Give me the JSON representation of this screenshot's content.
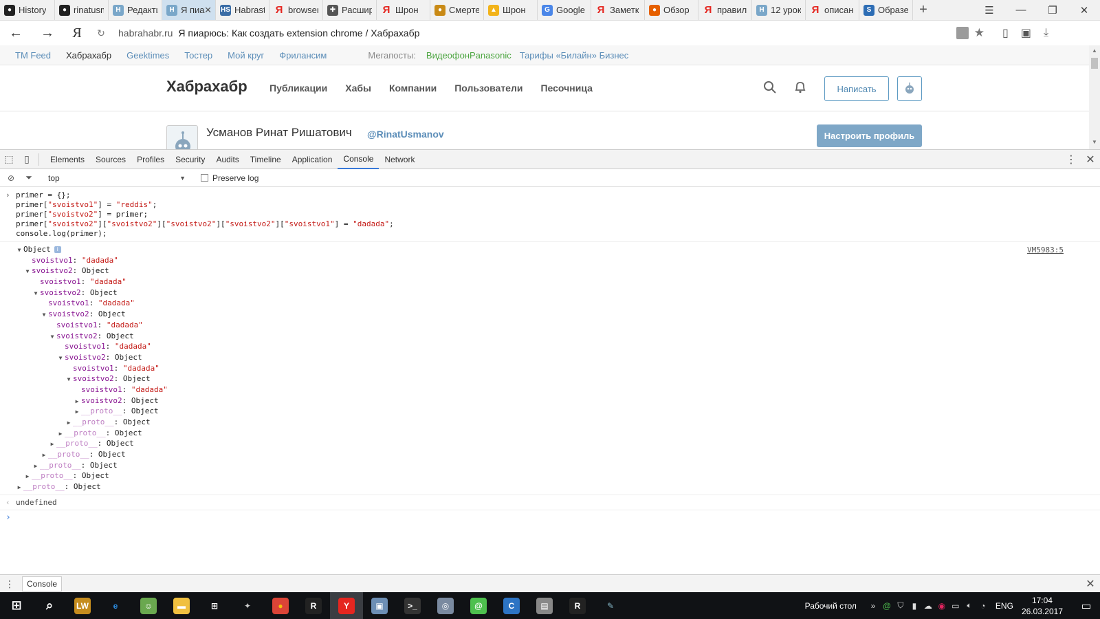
{
  "browser": {
    "tabs": [
      {
        "label": "History",
        "icon": "github-icon",
        "color": "#222222"
      },
      {
        "label": "rinatusm",
        "icon": "github-icon",
        "color": "#222222"
      },
      {
        "label": "Редакти",
        "icon": "habr-icon",
        "color": "#7aa7c9"
      },
      {
        "label": "Я пиа",
        "icon": "habr-icon",
        "color": "#7aa7c9",
        "active": true
      },
      {
        "label": "Habrast",
        "icon": "habrastorage-icon",
        "color": "#3b6da6"
      },
      {
        "label": "browser",
        "icon": "yandex-icon",
        "color": "#e52620"
      },
      {
        "label": "Расшир",
        "icon": "puzzle-icon",
        "color": "#555555"
      },
      {
        "label": "Шрон",
        "icon": "yandex-icon",
        "color": "#e52620"
      },
      {
        "label": "Смерте",
        "icon": "coin-icon",
        "color": "#c98a16"
      },
      {
        "label": "Шрон",
        "icon": "drive-icon",
        "color": "#f2b31a"
      },
      {
        "label": "Google",
        "icon": "google-translate-icon",
        "color": "#4a86e8"
      },
      {
        "label": "Заметк",
        "icon": "yandex-icon",
        "color": "#e52620"
      },
      {
        "label": "Обзор",
        "icon": "firefox-icon",
        "color": "#e66000"
      },
      {
        "label": "правил",
        "icon": "yandex-icon",
        "color": "#e52620"
      },
      {
        "label": "12 урок",
        "icon": "habr-icon",
        "color": "#7aa7c9"
      },
      {
        "label": "описан",
        "icon": "yandex-icon",
        "color": "#e52620"
      },
      {
        "label": "Образе",
        "icon": "s-icon",
        "color": "#2d6db5"
      }
    ],
    "address": {
      "host": "habrahabr.ru",
      "title": "Я пиарюсь: Как создать extension chrome / Хабрахабр"
    }
  },
  "habr": {
    "toplinks": [
      "TM Feed",
      "Хабрахабр",
      "Geektimes",
      "Тостер",
      "Мой круг",
      "Фрилансим"
    ],
    "megaposts_label": "Мегапосты:",
    "megaposts": [
      "ВидеофонPanasonic",
      "Тарифы «Билайн» Бизнес"
    ],
    "logo": "Хабрахабр",
    "nav": [
      "Публикации",
      "Хабы",
      "Компании",
      "Пользователи",
      "Песочница"
    ],
    "write_button": "Написать",
    "profile_name": "Усманов Ринат Ришатович",
    "profile_nick": "@RinatUsmanov",
    "profile_button": "Настроить профиль"
  },
  "devtools": {
    "tabs": [
      "Elements",
      "Sources",
      "Profiles",
      "Security",
      "Audits",
      "Timeline",
      "Application",
      "Console",
      "Network"
    ],
    "active_tab": "Console",
    "context": "top",
    "preserve_log": "Preserve log",
    "input_lines": [
      "primer = {};",
      "primer[\"svoistvo1\"] = \"reddis\";",
      "primer[\"svoistvo2\"] = primer;",
      "primer[\"svoistvo2\"][\"svoistvo2\"][\"svoistvo2\"][\"svoistvo2\"][\"svoistvo1\"] = \"dadada\";",
      "console.log(primer);"
    ],
    "log_source": "VM5983:5",
    "log_root": "Object",
    "tree_value": "\"dadada\"",
    "result": "undefined",
    "drawer_tab": "Console"
  },
  "taskbar": {
    "apps": [
      "start-icon",
      "search-icon",
      "lw-icon",
      "edge-icon",
      "android-icon",
      "explorer-icon",
      "store-icon",
      "app-icon",
      "chrome-icon",
      "rw-icon",
      "yandex-browser-icon",
      "app2-icon",
      "terminal-icon",
      "app3-icon",
      "icq-icon",
      "app4-icon",
      "app5-icon",
      "rw2-icon",
      "paint-icon"
    ],
    "desktop": "Рабочий стол",
    "lang": "ENG",
    "time": "17:04",
    "date": "26.03.2017"
  }
}
